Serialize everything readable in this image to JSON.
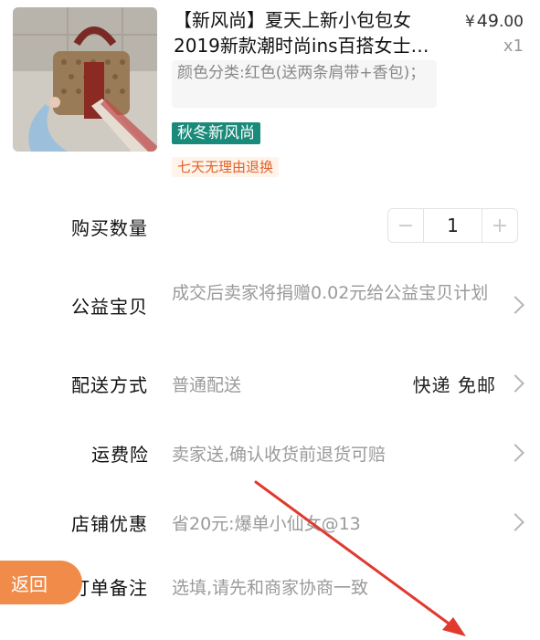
{
  "product": {
    "title": "【新风尚】夏天上新小包包女2019新款潮时尚ins百搭女士…",
    "price_currency": "¥",
    "price_int": "49",
    "price_dec": ".00",
    "quantity_display": "x1",
    "sku": "颜色分类:红色(送两条肩带+香包)；",
    "tag_season": "秋冬新风尚",
    "tag_return": "七天无理由退换"
  },
  "order": {
    "quantity_label": "购买数量",
    "quantity_value": "1",
    "minus_symbol": "−",
    "plus_symbol": "+",
    "charity_label": "公益宝贝",
    "charity_value": "成交后卖家将捐赠0.02元给公益宝贝计划",
    "delivery_label": "配送方式",
    "delivery_value": "普通配送",
    "delivery_right": "快递 免邮",
    "insurance_label": "运费险",
    "insurance_value": "卖家送,确认收货前退货可赔",
    "discount_label": "店铺优惠",
    "discount_value": "省20元:爆单小仙女@13",
    "note_label": "订单备注",
    "note_placeholder": "选填,请先和商家协商一致"
  },
  "floating": {
    "back_label": "返回"
  },
  "colors": {
    "tag_season_bg": "#1a8a7a",
    "tag_return_text": "#e0632a",
    "back_button_bg": "#f08b4a",
    "annotation_arrow": "#e03a2f"
  }
}
